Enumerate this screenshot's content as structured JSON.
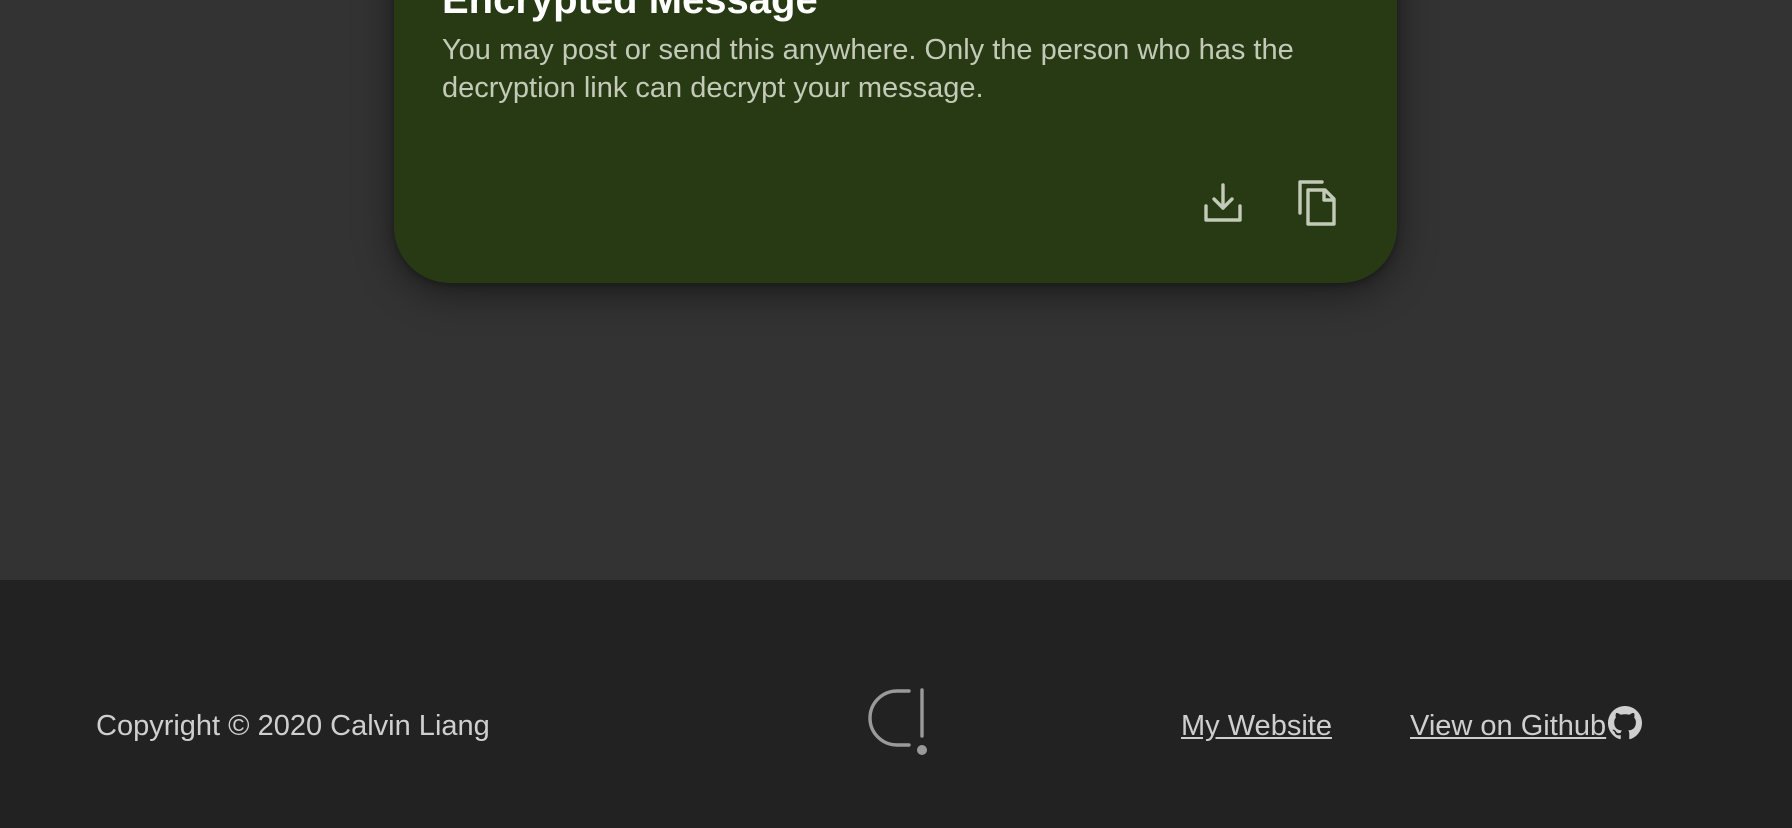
{
  "card": {
    "title": "Encrypted Message",
    "description": "You may post or send this anywhere. Only the person who has the decryption link can decrypt your message.",
    "actions": [
      {
        "name": "download",
        "icon": "download-icon"
      },
      {
        "name": "copy",
        "icon": "copy-icon"
      }
    ],
    "background_color": "#283a14"
  },
  "footer": {
    "copyright": "Copyright © 2020 Calvin Liang",
    "logo_icon": "c-exclamation-logo",
    "links": {
      "website": "My Website",
      "github": "View on Github "
    },
    "github_icon": "github-icon",
    "background_color": "#222222"
  },
  "colors": {
    "page_background": "#333333",
    "text_light": "#cfcfcf"
  }
}
